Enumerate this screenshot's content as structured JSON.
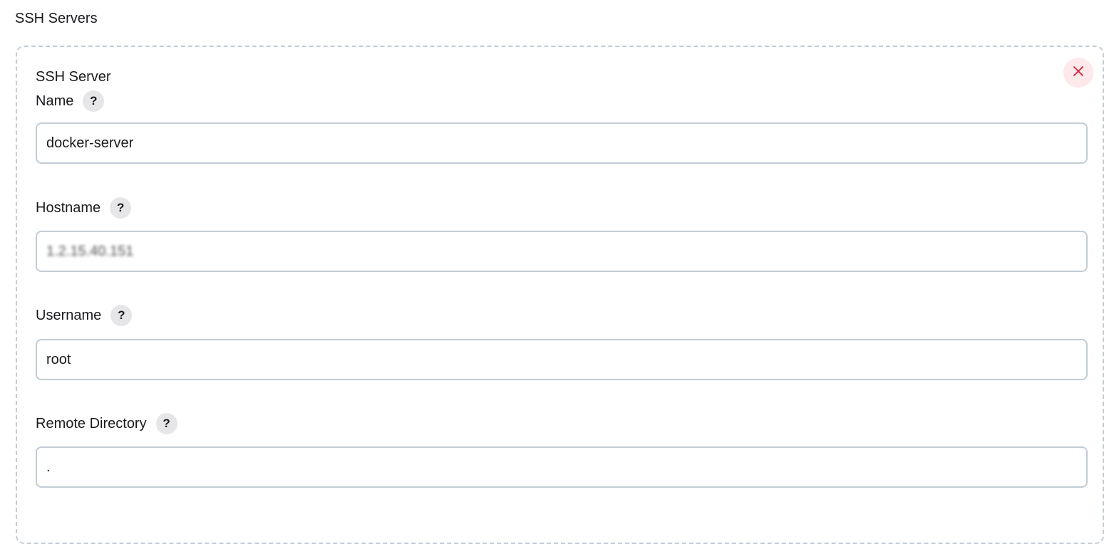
{
  "section": {
    "title": "SSH Servers"
  },
  "server": {
    "header": "SSH Server",
    "delete_icon": "close-icon",
    "accent_color": "#d5213c",
    "fields": {
      "name": {
        "label": "Name",
        "value": "docker-server",
        "help_icon": "question-icon"
      },
      "hostname": {
        "label": "Hostname",
        "value": "1.2.15.40.151",
        "help_icon": "question-icon"
      },
      "username": {
        "label": "Username",
        "value": "root",
        "help_icon": "question-icon"
      },
      "remote_directory": {
        "label": "Remote Directory",
        "value": ".",
        "help_icon": "question-icon"
      }
    }
  },
  "help_glyph": "?"
}
